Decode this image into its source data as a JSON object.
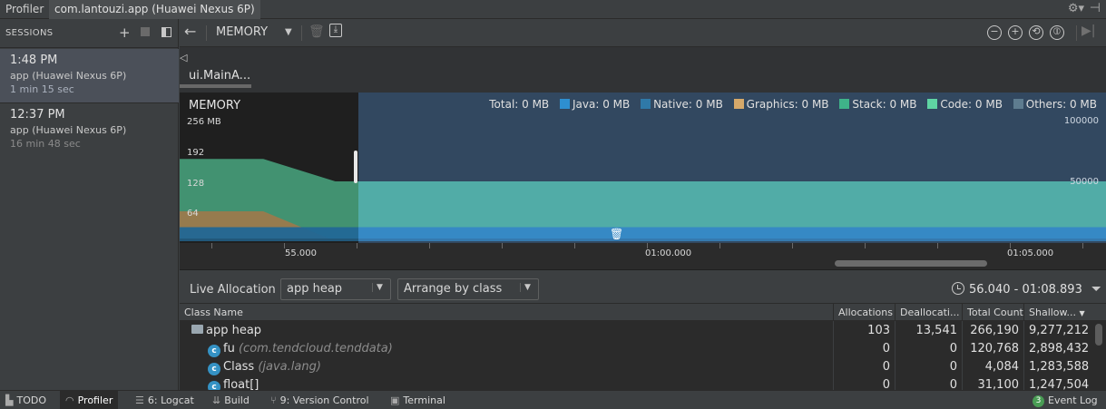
{
  "window": {
    "tabs": [
      "Profiler",
      "com.lantouzi.app (Huawei Nexus 6P)"
    ]
  },
  "sessions": {
    "title": "SESSIONS",
    "items": [
      {
        "time": "1:48 PM",
        "device": "app (Huawei Nexus 6P)",
        "duration": "1 min 15 sec",
        "selected": true
      },
      {
        "time": "12:37 PM",
        "device": "app (Huawei Nexus 6P)",
        "duration": "16 min 48 sec",
        "selected": false
      }
    ]
  },
  "toolbar": {
    "profiler_select": "MEMORY"
  },
  "events": {
    "activity": "ui.MainA..."
  },
  "chart_data": {
    "type": "area",
    "title": "MEMORY",
    "ylabel_left_ticks": [
      "256 MB",
      "192",
      "128",
      "64"
    ],
    "ylabel_right_ticks": [
      "100000",
      "50000"
    ],
    "x_tick_labels": [
      "55.000",
      "01:00.000",
      "01:05.000"
    ],
    "ylim": [
      0,
      256
    ],
    "legend_position": "top-right",
    "legend": [
      {
        "label": "Total: 0 MB",
        "color": null
      },
      {
        "label": "Java: 0 MB",
        "color": "#2e8fd0"
      },
      {
        "label": "Native: 0 MB",
        "color": "#2f79a8"
      },
      {
        "label": "Graphics: 0 MB",
        "color": "#d6a96a"
      },
      {
        "label": "Stack: 0 MB",
        "color": "#3fb389"
      },
      {
        "label": "Code: 0 MB",
        "color": "#5fd4a3"
      },
      {
        "label": "Others: 0 MB",
        "color": "#5e7c8f"
      }
    ],
    "x": [
      52.5,
      53.3,
      54.7,
      55.7,
      57.0,
      62.0,
      64.0,
      68.8
    ],
    "series": [
      {
        "name": "Java",
        "values": [
          30,
          30,
          30,
          30,
          30,
          30,
          30,
          30
        ]
      },
      {
        "name": "Graphics",
        "values": [
          64,
          64,
          64,
          0,
          0,
          0,
          0,
          0
        ]
      },
      {
        "name": "Code",
        "values": [
          176,
          176,
          176,
          128,
          128,
          128,
          128,
          128
        ]
      }
    ],
    "selection_range": "56.040 - 01:08.893"
  },
  "allocation": {
    "mode_label": "Live Allocation",
    "heap": "app heap",
    "arrange": "Arrange by class",
    "range": "56.040 - 01:08.893"
  },
  "table": {
    "columns": [
      "Class Name",
      "Allocations",
      "Deallocati...",
      "Total Count",
      "Shallow..."
    ],
    "rows": [
      {
        "name": "app heap",
        "pkg": "",
        "allocations": "103",
        "deallocations": "13,541",
        "total": "266,190",
        "shallow": "9,277,212",
        "kind": "folder"
      },
      {
        "name": "fu",
        "pkg": "(com.tendcloud.tenddata)",
        "allocations": "0",
        "deallocations": "0",
        "total": "120,768",
        "shallow": "2,898,432",
        "kind": "class"
      },
      {
        "name": "Class",
        "pkg": "(java.lang)",
        "allocations": "0",
        "deallocations": "0",
        "total": "4,084",
        "shallow": "1,283,588",
        "kind": "class"
      },
      {
        "name": "float[]",
        "pkg": "",
        "allocations": "0",
        "deallocations": "0",
        "total": "31,100",
        "shallow": "1,247,504",
        "kind": "class"
      }
    ]
  },
  "statusbar": {
    "items": [
      "TODO",
      "Profiler",
      "6: Logcat",
      "Build",
      "9: Version Control",
      "Terminal"
    ],
    "event_log": "Event Log",
    "event_count": "3"
  }
}
